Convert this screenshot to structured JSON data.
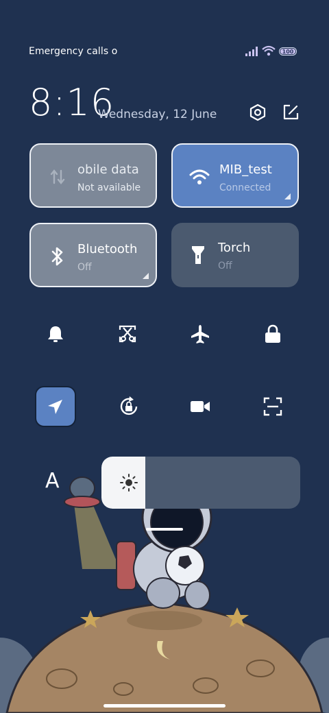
{
  "status_bar": {
    "left_text": "Emergency calls o",
    "battery": "100",
    "icons": [
      "signal-icon",
      "wifi-icon",
      "battery-icon"
    ]
  },
  "header": {
    "time": "8:16",
    "date": "Wednesday, 12 June",
    "icons": [
      "settings-icon",
      "edit-icon"
    ]
  },
  "tiles": [
    {
      "title": "obile data",
      "subtitle": "Not available",
      "icon": "mobile-data-icon"
    },
    {
      "title": "MIB_test",
      "subtitle": "Connected",
      "icon": "wifi-icon"
    },
    {
      "title": "Bluetooth",
      "subtitle": "Off",
      "icon": "bluetooth-icon"
    },
    {
      "title": "Torch",
      "subtitle": "Off",
      "icon": "torch-icon"
    }
  ],
  "toggles_row1": [
    "bell-icon",
    "screenshot-icon",
    "airplane-icon",
    "lock-icon"
  ],
  "toggles_row2": [
    "location-icon",
    "rotation-lock-icon",
    "video-icon",
    "scan-icon"
  ],
  "brightness": {
    "font_label": "A",
    "level_percent": 22
  },
  "colors": {
    "background": "#1f3150",
    "accent_blue": "#5b82c2",
    "tile_gray": "#7d8898",
    "tile_dark": "#4b5a6f"
  }
}
